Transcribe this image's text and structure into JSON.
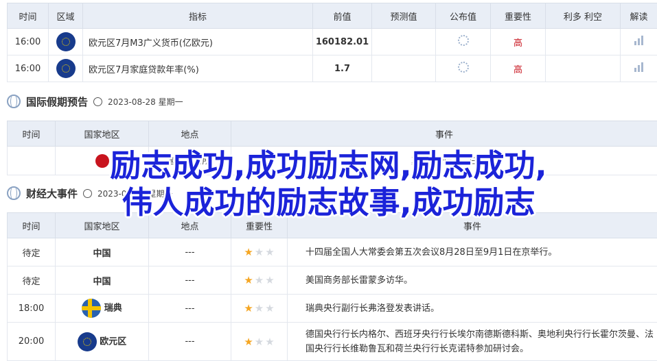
{
  "econ_table": {
    "headers": [
      "时间",
      "区域",
      "指标",
      "前值",
      "预测值",
      "公布值",
      "重要性",
      "利多 利空",
      "解读"
    ],
    "rows": [
      {
        "time": "16:00",
        "region_flag": "eu-flag",
        "indicator": "欧元区7月M3广义货币(亿欧元)",
        "previous": "160182.01",
        "forecast": "",
        "actual_icon": "loading-icon",
        "importance": "高",
        "interpret_icon": "chart-icon"
      },
      {
        "time": "16:00",
        "region_flag": "eu-flag",
        "indicator": "欧元区7月家庭贷款年率(%)",
        "previous": "1.7",
        "forecast": "",
        "actual_icon": "loading-icon",
        "importance": "高",
        "interpret_icon": "chart-icon"
      }
    ]
  },
  "holiday_section": {
    "title": "国际假期预告",
    "date": "2023-08-28 星期一"
  },
  "holiday_table": {
    "headers": [
      "时间",
      "国家地区",
      "地点",
      "事件"
    ],
    "partial_row": {
      "col2": "欧证券易所",
      "col3": "夏季银行假日一日"
    }
  },
  "finance_section": {
    "title": "财经大事件",
    "date": "2023-08-28 星期一"
  },
  "events_table": {
    "headers": [
      "时间",
      "国家地区",
      "地点",
      "重要性",
      "事件"
    ],
    "rows": [
      {
        "time": "待定",
        "country": "中国",
        "flag": "",
        "place": "---",
        "stars": 1,
        "event": "十四届全国人大常委会第五次会议8月28日至9月1日在京举行。"
      },
      {
        "time": "待定",
        "country": "中国",
        "flag": "",
        "place": "---",
        "stars": 1,
        "event": "美国商务部长雷蒙多访华。"
      },
      {
        "time": "18:00",
        "country": "瑞典",
        "flag": "se-flag",
        "place": "---",
        "stars": 1,
        "event": "瑞典央行副行长弗洛登发表讲话。"
      },
      {
        "time": "20:00",
        "country": "欧元区",
        "flag": "eu-flag",
        "place": "---",
        "stars": 1,
        "event": "德国央行行长内格尔、西班牙央行行长埃尔南德斯德科斯、奥地利央行行长霍尔茨曼、法国央行行长维勒鲁瓦和荷兰央行行长克诺特参加研讨会。"
      }
    ]
  },
  "banner": {
    "line1": "励志成功,成功励志网,励志成功,",
    "line2": "伟人成功的励志故事,成功励志"
  },
  "colors": {
    "header_bg": "#e9eef6",
    "red": "#c8141e",
    "banner_blue": "#1b23d9",
    "star_on": "#f5a623"
  }
}
